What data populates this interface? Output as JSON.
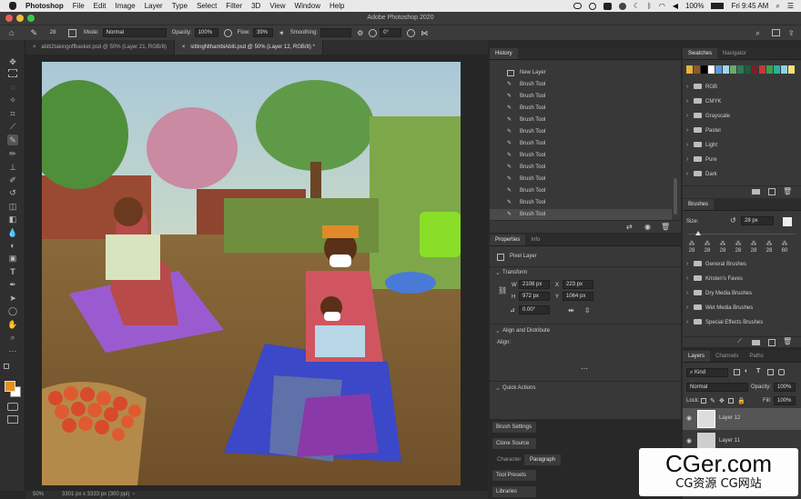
{
  "menubar": {
    "apple": "",
    "app": "Photoshop",
    "items": [
      "File",
      "Edit",
      "Image",
      "Layer",
      "Type",
      "Select",
      "Filter",
      "3D",
      "View",
      "Window",
      "Help"
    ],
    "battery": "100%",
    "clock": "Fri 9:45 AM"
  },
  "window": {
    "title": "Adobe Photoshop 2020"
  },
  "options": {
    "brush_size": "28",
    "mode_label": "Mode:",
    "mode_value": "Normal",
    "opacity_label": "Opacity:",
    "opacity_value": "100%",
    "flow_label": "Flow:",
    "flow_value": "39%",
    "smoothing_label": "Smoothing:",
    "angle_value": "0°"
  },
  "tabs": [
    {
      "label": "abiti2takingoffbasket.psd @ 50% (Layer 21, RGB/8)",
      "close": "×"
    },
    {
      "label": "sittingNthambiAbiti.psd @ 50% (Layer 12, RGB/8) *",
      "close": "×"
    }
  ],
  "status": {
    "zoom": "50%",
    "doc": "3301 px x 3333 px (300 ppi)"
  },
  "history": {
    "tabs": [
      "History"
    ],
    "items": [
      "New Layer",
      "Brush Tool",
      "Brush Tool",
      "Brush Tool",
      "Brush Tool",
      "Brush Tool",
      "Brush Tool",
      "Brush Tool",
      "Brush Tool",
      "Brush Tool",
      "Brush Tool",
      "Brush Tool",
      "Brush Tool"
    ]
  },
  "swatches": {
    "tabs": [
      "Swatches",
      "Navigator"
    ],
    "colors": [
      "#000000",
      "#ffffff",
      "#e8b33a",
      "#8a5a2b",
      "#5d9bd6",
      "#a4d4f0",
      "#d5e5c0",
      "#6fa86b",
      "#2a7a5b",
      "#1f5b3b",
      "#7a1f2a",
      "#c43a3a",
      "#3d9f4a",
      "#2bb0a0",
      "#8fd0e8",
      "#f2e07a"
    ],
    "folders": [
      "RGB",
      "CMYK",
      "Grayscale",
      "Pastel",
      "Light",
      "Pure",
      "Dark"
    ]
  },
  "properties": {
    "tabs": [
      "Properties",
      "Info"
    ],
    "layer_type": "Pixel Layer",
    "transform": "Transform",
    "w_label": "W",
    "w": "2108 px",
    "h_label": "H",
    "h": "972 px",
    "x_label": "X",
    "x": "223 px",
    "y_label": "Y",
    "y": "1064 px",
    "angle": "0.00°",
    "align": "Align and Distribute",
    "align_label": "Align:",
    "quick": "Quick Actions"
  },
  "brushes": {
    "tabs": [
      "Brushes"
    ],
    "size_label": "Size:",
    "size": "28 px",
    "presets": [
      "28",
      "28",
      "28",
      "28",
      "28",
      "28",
      "60"
    ],
    "folders": [
      "General Brushes",
      "Kristen's Faves",
      "Dry Media Brushes",
      "Wet Media Brushes",
      "Special Effects Brushes"
    ]
  },
  "layers": {
    "tabs": [
      "Layers",
      "Channels",
      "Paths"
    ],
    "kind": "Kind",
    "blend": "Normal",
    "opacity_label": "Opacity:",
    "opacity": "100%",
    "lock_label": "Lock:",
    "fill_label": "Fill:",
    "fill": "100%",
    "items": [
      "Layer 12",
      "Layer 11"
    ]
  },
  "collapsed": [
    "Brush Settings",
    "Clone Source",
    "Tool Presets",
    "Libraries"
  ],
  "paragraph_tabs": [
    "Character",
    "Paragraph"
  ],
  "watermark": {
    "main": "CGer.com",
    "sub": "CG资源 CG网站"
  }
}
